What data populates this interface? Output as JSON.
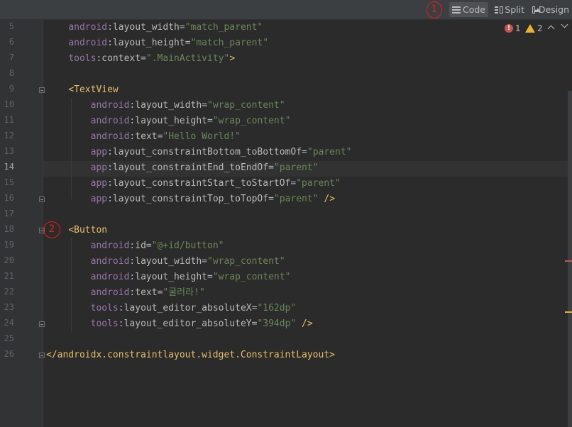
{
  "toolbar": {
    "annotation_1": "1",
    "code_label": "Code",
    "split_label": "Split",
    "design_label": "Design",
    "active_view": "Code"
  },
  "status": {
    "errors": "1",
    "warnings": "2",
    "icons": [
      "error-icon",
      "warning-icon",
      "arrow-up-icon",
      "arrow-down-icon"
    ]
  },
  "annotation_2": "2",
  "current_line": "14",
  "lines": [
    {
      "n": "5",
      "t": "    android:layout_width=\"match_parent\""
    },
    {
      "n": "6",
      "t": "    android:layout_height=\"match_parent\""
    },
    {
      "n": "7",
      "t": "    tools:context=\".MainActivity\">"
    },
    {
      "n": "8",
      "t": ""
    },
    {
      "n": "9",
      "t": "    <TextView"
    },
    {
      "n": "10",
      "t": "        android:layout_width=\"wrap_content\""
    },
    {
      "n": "11",
      "t": "        android:layout_height=\"wrap_content\""
    },
    {
      "n": "12",
      "t": "        android:text=\"Hello World!\""
    },
    {
      "n": "13",
      "t": "        app:layout_constraintBottom_toBottomOf=\"parent\""
    },
    {
      "n": "14",
      "t": "        app:layout_constraintEnd_toEndOf=\"parent\""
    },
    {
      "n": "15",
      "t": "        app:layout_constraintStart_toStartOf=\"parent\""
    },
    {
      "n": "16",
      "t": "        app:layout_constraintTop_toTopOf=\"parent\" />"
    },
    {
      "n": "17",
      "t": ""
    },
    {
      "n": "18",
      "t": "    <Button"
    },
    {
      "n": "19",
      "t": "        android:id=\"@+id/button\""
    },
    {
      "n": "20",
      "t": "        android:layout_width=\"wrap_content\""
    },
    {
      "n": "21",
      "t": "        android:layout_height=\"wrap_content\""
    },
    {
      "n": "22",
      "t": "        android:text=\"굴러라!\""
    },
    {
      "n": "23",
      "t": "        tools:layout_editor_absoluteX=\"162dp\""
    },
    {
      "n": "24",
      "t": "        tools:layout_editor_absoluteY=\"394dp\" />"
    },
    {
      "n": "25",
      "t": ""
    },
    {
      "n": "26",
      "t": "</androidx.constraintlayout.widget.ConstraintLayout>"
    }
  ],
  "colors": {
    "background": "#2b2b2b",
    "namespace": "#9876aa",
    "attribute": "#bababa",
    "string": "#6a8759",
    "tag": "#e8bf6a",
    "annotation": "#e02020"
  }
}
